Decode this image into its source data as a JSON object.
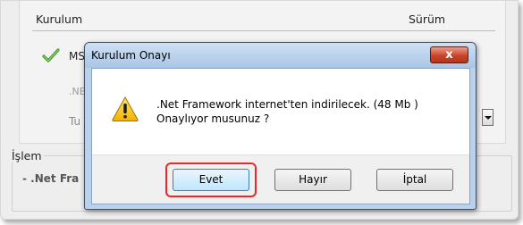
{
  "background": {
    "columns": {
      "kurulum": "Kurulum",
      "surum": "Sürüm"
    },
    "rows": [
      {
        "label": "MS",
        "icon": "checkmark-icon"
      },
      {
        "label": ".NE"
      },
      {
        "label": "Tu"
      }
    ],
    "islem": {
      "title": "İşlem",
      "line": "- .Net Fra"
    }
  },
  "dialog": {
    "title": "Kurulum Onayı",
    "close_label": "x",
    "message_line1": ".Net Framework internet'ten indirilecek. (48 Mb )",
    "message_line2": "Onaylıyor musunuz ?",
    "icon": "warning-icon",
    "buttons": {
      "evet": "Evet",
      "hayir": "Hayır",
      "iptal": "İptal"
    }
  },
  "colors": {
    "highlight": "#e8282c",
    "titlebar": "#b9d1ea",
    "close": "#c7452a"
  }
}
